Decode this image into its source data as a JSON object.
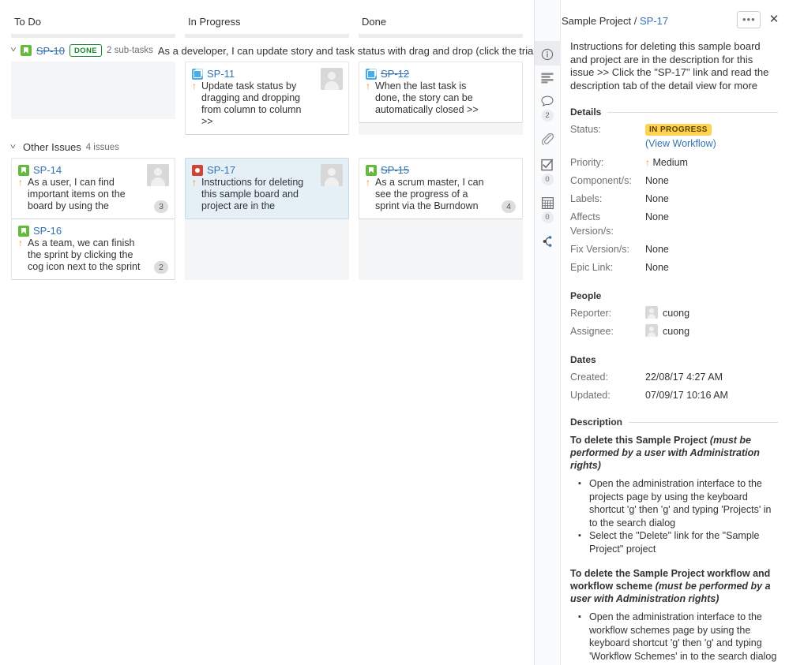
{
  "board": {
    "columns": [
      {
        "name": "To Do"
      },
      {
        "name": "In Progress"
      },
      {
        "name": "Done"
      }
    ],
    "swimlanes": [
      {
        "id": "sp10",
        "icon": "story-icon",
        "key": "SP-10",
        "key_strikethrough": true,
        "badge": "DONE",
        "subtasks": "2 sub-tasks",
        "summary": "As a developer, I can update story and task status with drag and drop (click the triangle at far",
        "cards": {
          "todo": [],
          "inprogress": [
            {
              "type": "subtask-icon",
              "key": "SP-11",
              "key_strikethrough": false,
              "priority": "medium-priority-icon",
              "summary": "Update task status by dragging and dropping from column to column >>",
              "avatar": true,
              "estimate": null,
              "selected": false
            }
          ],
          "done": [
            {
              "type": "subtask-icon",
              "key": "SP-12",
              "key_strikethrough": true,
              "priority": "medium-priority-icon",
              "summary": "When the last task is done, the story can be automatically closed >>",
              "avatar": false,
              "estimate": null,
              "selected": false
            }
          ]
        }
      },
      {
        "id": "other",
        "icon": null,
        "key": null,
        "key_strikethrough": false,
        "badge": null,
        "subtasks": null,
        "summary": "Other Issues",
        "count": "4 issues",
        "cards": {
          "todo": [
            {
              "type": "story-icon",
              "key": "SP-14",
              "key_strikethrough": false,
              "priority": "medium-priority-icon",
              "summary": "As a user, I can find important items on the board by using the",
              "avatar": true,
              "estimate": "3",
              "selected": false
            },
            {
              "type": "story-icon",
              "key": "SP-16",
              "key_strikethrough": false,
              "priority": "medium-priority-icon",
              "summary": "As a team, we can finish the sprint by clicking the cog icon next to the sprint",
              "avatar": false,
              "estimate": "2",
              "selected": false
            }
          ],
          "inprogress": [
            {
              "type": "bug-icon",
              "key": "SP-17",
              "key_strikethrough": false,
              "priority": "medium-priority-icon",
              "summary": "Instructions for deleting this sample board and project are in the",
              "avatar": true,
              "estimate": null,
              "selected": true
            }
          ],
          "done": [
            {
              "type": "story-icon",
              "key": "SP-15",
              "key_strikethrough": true,
              "priority": "medium-priority-icon",
              "summary": "As a scrum master, I can see the progress of a sprint via the Burndown",
              "avatar": false,
              "estimate": "4",
              "selected": false
            }
          ]
        }
      }
    ]
  },
  "detail": {
    "rail": [
      {
        "icon": "info-icon",
        "count": null,
        "active": true
      },
      {
        "icon": "description-icon",
        "count": null,
        "active": false
      },
      {
        "icon": "comment-icon",
        "count": "2",
        "active": false
      },
      {
        "icon": "attachment-icon",
        "count": null,
        "active": false
      },
      {
        "icon": "subtask-checkbox-icon",
        "count": "0",
        "active": false
      },
      {
        "icon": "worklog-grid-icon",
        "count": "0",
        "active": false
      },
      {
        "icon": "issue-links-icon",
        "count": null,
        "active": false
      }
    ],
    "breadcrumb_project": "Sample Project",
    "breadcrumb_sep": " / ",
    "breadcrumb_key": "SP-17",
    "more_label": "•••",
    "close_label": "✕",
    "summary": "Instructions for deleting this sample board and project are in the description for this issue >> Click the \"SP-17\" link and read the description tab of the detail view for more",
    "sections": {
      "details_title": "Details",
      "people_title": "People",
      "dates_title": "Dates",
      "description_title": "Description"
    },
    "details": [
      {
        "label": "Status:",
        "value": "IN PROGRESS",
        "kind": "lozenge",
        "sub": "(View Workflow)"
      },
      {
        "label": "Priority:",
        "value": "Medium",
        "kind": "priority"
      },
      {
        "label": "Component/s:",
        "value": "None",
        "kind": "text"
      },
      {
        "label": "Labels:",
        "value": "None",
        "kind": "text"
      },
      {
        "label": "Affects Version/s:",
        "value": "None",
        "kind": "text"
      },
      {
        "label": "Fix Version/s:",
        "value": "None",
        "kind": "text"
      },
      {
        "label": "Epic Link:",
        "value": "None",
        "kind": "text"
      }
    ],
    "people": [
      {
        "label": "Reporter:",
        "value": "cuong"
      },
      {
        "label": "Assignee:",
        "value": "cuong"
      }
    ],
    "dates": [
      {
        "label": "Created:",
        "value": "22/08/17 4:27 AM"
      },
      {
        "label": "Updated:",
        "value": "07/09/17 10:16 AM"
      }
    ],
    "description": [
      {
        "heading_bold": "To delete this Sample Project ",
        "heading_italic": "(must be performed by a user with Administration rights)",
        "bullets": [
          "Open the administration interface to the projects page by using the keyboard shortcut 'g' then 'g' and typing 'Projects' in to the search dialog",
          "Select the \"Delete\" link for the \"Sample Project\" project"
        ]
      },
      {
        "heading_bold": "To delete the Sample Project workflow and workflow scheme ",
        "heading_italic": "(must be performed by a user with Administration rights)",
        "bullets": [
          "Open the administration interface to the workflow schemes page by using the keyboard shortcut 'g' then 'g' and typing 'Workflow Schemes' in to the search dialog"
        ]
      }
    ]
  },
  "colors": {
    "link": "#3572b0",
    "story": "#63ba3c",
    "subtask": "#4bade8",
    "bug": "#d04437",
    "priority": "#f08c28",
    "status_bg": "#ffd351",
    "selected_card": "#e4f0f6",
    "lane_bg": "#f4f5f7"
  }
}
